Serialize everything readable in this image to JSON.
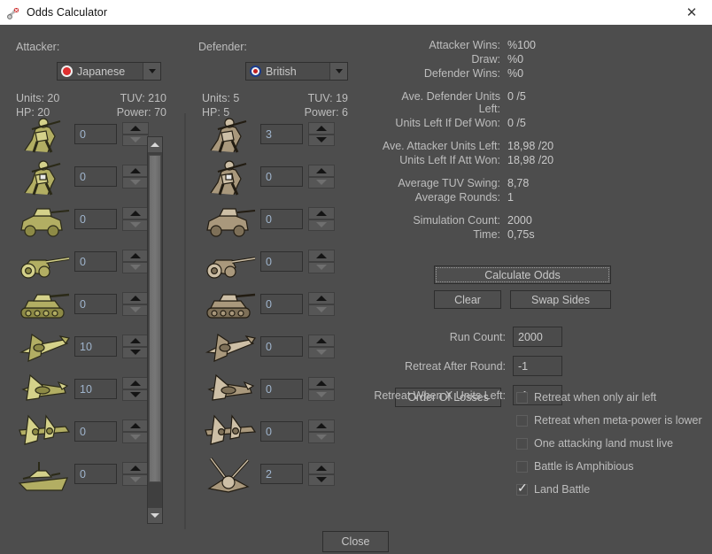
{
  "window": {
    "title": "Odds Calculator",
    "app_icon": "artillery-icon",
    "close_icon": "close-icon",
    "close_button_label": "Close"
  },
  "colors": {
    "window_bg": "#4d4d4d",
    "titlebar_bg": "#ffffff",
    "label_text": "#bdbdbd",
    "value_text": "#c9c9c9",
    "input_bg": "#4b4b4b",
    "input_text": "#9fb4cc",
    "button_bg": "#4e4e4e",
    "japanese_flag": "#e03030",
    "british_flag": "#1b3c8c"
  },
  "attacker": {
    "caption": "Attacker:",
    "faction": "Japanese",
    "flag_icon": "japanese-flag-icon",
    "stats": [
      {
        "label": "Units: 20",
        "label2": "TUV: 210"
      },
      {
        "label": "HP: 20",
        "label2": "Power: 70"
      }
    ],
    "units_label": "Units: 20",
    "tuv_label": "TUV: 210",
    "hp_label": "HP: 20",
    "power_label": "Power: 70",
    "units": [
      {
        "icon": "infantry-icon",
        "count": "0"
      },
      {
        "icon": "mech-infantry-icon",
        "count": "0"
      },
      {
        "icon": "armored-car-icon",
        "count": "0"
      },
      {
        "icon": "artillery-icon",
        "count": "0"
      },
      {
        "icon": "tank-icon",
        "count": "0"
      },
      {
        "icon": "fighter-icon",
        "count": "10"
      },
      {
        "icon": "tactical-bomber-icon",
        "count": "10"
      },
      {
        "icon": "strategic-bomber-icon",
        "count": "0"
      },
      {
        "icon": "battleship-icon",
        "count": "0"
      }
    ]
  },
  "defender": {
    "caption": "Defender:",
    "faction": "British",
    "flag_icon": "british-roundel-icon",
    "units_label": "Units: 5",
    "tuv_label": "TUV: 19",
    "hp_label": "HP: 5",
    "power_label": "Power: 6",
    "units": [
      {
        "icon": "infantry-icon",
        "count": "3"
      },
      {
        "icon": "mech-infantry-icon",
        "count": "0"
      },
      {
        "icon": "armored-car-icon",
        "count": "0"
      },
      {
        "icon": "artillery-icon",
        "count": "0"
      },
      {
        "icon": "tank-icon",
        "count": "0"
      },
      {
        "icon": "fighter-icon",
        "count": "0"
      },
      {
        "icon": "tactical-bomber-icon",
        "count": "0"
      },
      {
        "icon": "strategic-bomber-icon",
        "count": "0"
      },
      {
        "icon": "aa-gun-icon",
        "count": "2"
      }
    ]
  },
  "results": [
    {
      "label": "Attacker Wins:",
      "value": "%100"
    },
    {
      "label": "Draw:",
      "value": "%0"
    },
    {
      "label": "Defender Wins:",
      "value": "%0"
    },
    {
      "label": "Ave. Defender Units Left:",
      "value": "0 /5"
    },
    {
      "label": "Units Left If Def Won:",
      "value": "0 /5"
    },
    {
      "label": "Ave. Attacker Units Left:",
      "value": "18,98 /20"
    },
    {
      "label": "Units Left If Att Won:",
      "value": "18,98 /20"
    },
    {
      "label": "Average TUV Swing:",
      "value": "8,78"
    },
    {
      "label": "Average Rounds:",
      "value": "1"
    },
    {
      "label": "Simulation Count:",
      "value": "2000"
    },
    {
      "label": "Time:",
      "value": "0,75s"
    }
  ],
  "actions": {
    "calculate": "Calculate Odds",
    "clear": "Clear",
    "swap": "Swap Sides",
    "order_of_losses": "Order Of Losses"
  },
  "fields": [
    {
      "label": "Run Count:",
      "value": "2000"
    },
    {
      "label": "Retreat After Round:",
      "value": "-1"
    },
    {
      "label": "Retreat When X Units Left:",
      "value": "-1"
    }
  ],
  "checkboxes": [
    {
      "label": "Retreat when only air left",
      "checked": false
    },
    {
      "label": "Retreat when meta-power is lower",
      "checked": false
    },
    {
      "label": "One attacking land must live",
      "checked": false
    },
    {
      "label": "Battle is Amphibious",
      "checked": false
    },
    {
      "label": "Land Battle",
      "checked": true
    }
  ],
  "scrollbar": {
    "up_icon": "chevron-up-icon",
    "down_icon": "chevron-down-icon"
  }
}
